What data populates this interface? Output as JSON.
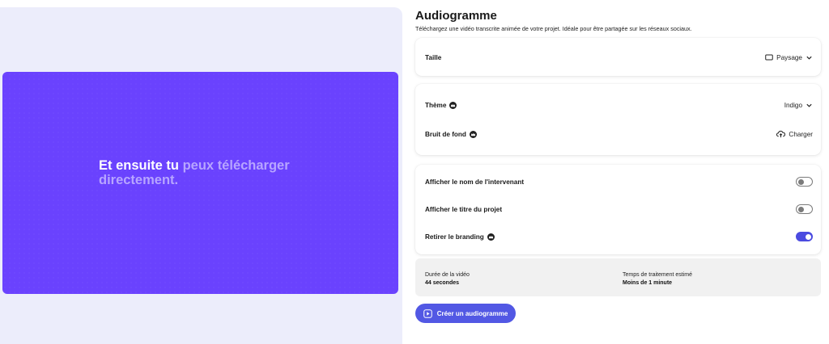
{
  "preview": {
    "caption_spoken": "Et ensuite tu ",
    "caption_upcoming": "peux télécharger directement.",
    "background_color": "#6a42fe"
  },
  "header": {
    "title": "Audiogramme",
    "subtitle": "Téléchargez une vidéo transcrite animée de votre projet. Idéale pour être partagée sur les réseaux sociaux."
  },
  "size": {
    "label": "Taille",
    "value": "Paysage",
    "icon": "landscape-icon"
  },
  "theme": {
    "label": "Thème",
    "value": "Indigo",
    "icon": "premium-crown-icon"
  },
  "background_noise": {
    "label": "Bruit de fond",
    "action": "Charger",
    "icon": "upload-cloud-icon"
  },
  "toggles": {
    "speaker_name": {
      "label": "Afficher le nom de l'intervenant",
      "on": false
    },
    "project_title": {
      "label": "Afficher le titre du projet",
      "on": false
    },
    "remove_branding": {
      "label": "Retirer le branding",
      "on": true
    }
  },
  "info": {
    "duration_label": "Durée de la vidéo",
    "duration_value": "44 secondes",
    "processing_label": "Temps de traitement estimé",
    "processing_value": "Moins de 1 minute"
  },
  "create_button": {
    "label": "Créer un audiogramme",
    "color": "#5258e4"
  }
}
